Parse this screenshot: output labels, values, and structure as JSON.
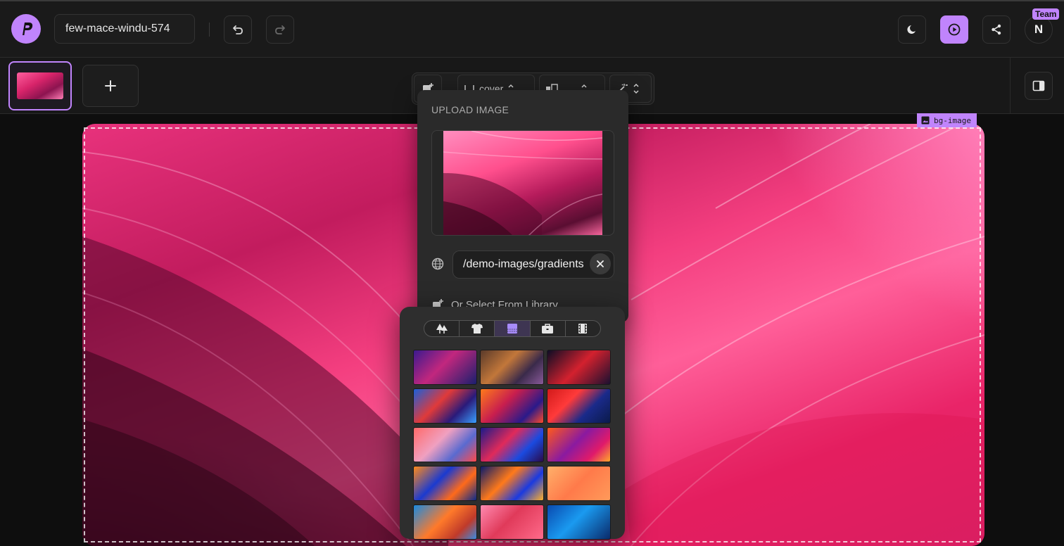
{
  "header": {
    "project_name": "few-mace-windu-574",
    "avatar_initial": "N",
    "team_badge": "Team",
    "accent_color": "#c084fc"
  },
  "toolbar": {
    "fit_label": "cover"
  },
  "canvas": {
    "selection_label": "bg-image"
  },
  "upload_panel": {
    "title": "UPLOAD IMAGE",
    "url_value": "/demo-images/gradients",
    "library_label": "Or Select From Library"
  },
  "library": {
    "tabs": [
      "tree-icon",
      "shirt-icon",
      "gradient-icon",
      "briefcase-icon",
      "film-icon"
    ],
    "active_tab": "gradient-icon",
    "tiles": [
      "linear-gradient(135deg,#3b1a8f,#c2277e 45%,#1a1f6e)",
      "linear-gradient(135deg,#5a3a2a,#c2773a 40%,#3a2a4a 70%,#8a5a9a)",
      "linear-gradient(135deg,#0d0d25,#d3212e 50%,#1a1030)",
      "linear-gradient(135deg,#1b5fd9,#e03a3a 40%,#2a1a7a 70%,#3aa0ff)",
      "linear-gradient(135deg,#ff7a1a,#c81e4e 40%,#2a1a8a 75%,#ff4a2a)",
      "linear-gradient(135deg,#d21a1a,#ff3a3a 35%,#1a2a8a 65%,#0a1a4a)",
      "linear-gradient(135deg,#ff6a6a,#f0a0c0 40%,#5a6ad0 70%,#ff4a4a)",
      "linear-gradient(135deg,#1a1a8a,#e02a5a 40%,#1a4ae0 70%,#2a0a4a)",
      "linear-gradient(135deg,#ff5a1a,#8a1aa0 45%,#e01a6a 75%,#ffaa2a)",
      "linear-gradient(135deg,#ff8a1a,#1a3ad0 40%,#ff6a1a 70%,#0a2a8a)",
      "linear-gradient(135deg,#0a1a6a,#ff7a1a 40%,#1a3ae0 70%,#ffb02a)",
      "linear-gradient(135deg,#ffb06a,#ff7a4a 50%,#ff9a5a)",
      "linear-gradient(135deg,#1a8ae0,#ff7a2a 45%,#c03a2a 75%,#3a8ae0)",
      "linear-gradient(135deg,#ff8ab0,#e03a5a 45%,#ff6a8a)",
      "linear-gradient(135deg,#0a4ab0,#1a9af0 45%,#0a2a6a)"
    ]
  }
}
